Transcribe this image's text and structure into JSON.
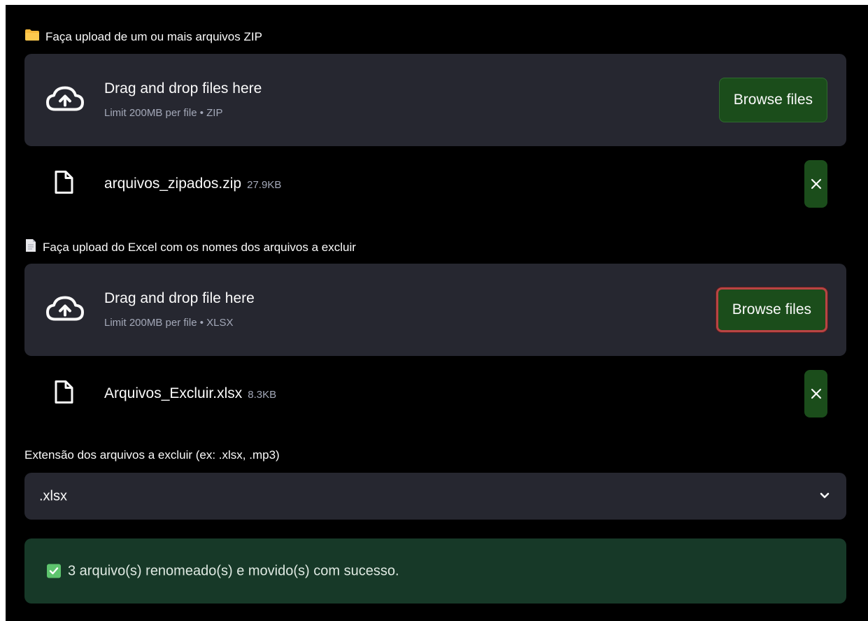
{
  "zip_uploader": {
    "label": "Faça upload de um ou mais arquivos ZIP",
    "label_icon": "folder-icon",
    "dropzone_title": "Drag and drop files here",
    "dropzone_limit": "Limit 200MB per file • ZIP",
    "browse_label": "Browse files",
    "file": {
      "name": "arquivos_zipados.zip",
      "size": "27.9KB"
    }
  },
  "excel_uploader": {
    "label": "Faça upload do Excel com os nomes dos arquivos a excluir",
    "label_icon": "document-icon",
    "dropzone_title": "Drag and drop file here",
    "dropzone_limit": "Limit 200MB per file • XLSX",
    "browse_label": "Browse files",
    "file": {
      "name": "Arquivos_Excluir.xlsx",
      "size": "8.3KB"
    }
  },
  "extension_select": {
    "label": "Extensão dos arquivos a excluir (ex: .xlsx, .mp3)",
    "value": ".xlsx"
  },
  "success": {
    "message": "3 arquivo(s) renomeado(s) e movido(s) com sucesso."
  },
  "colors": {
    "background": "#000000",
    "panel": "#262730",
    "button": "#1b4d1b",
    "focus_border": "#b84444",
    "success_bg": "#173928"
  }
}
